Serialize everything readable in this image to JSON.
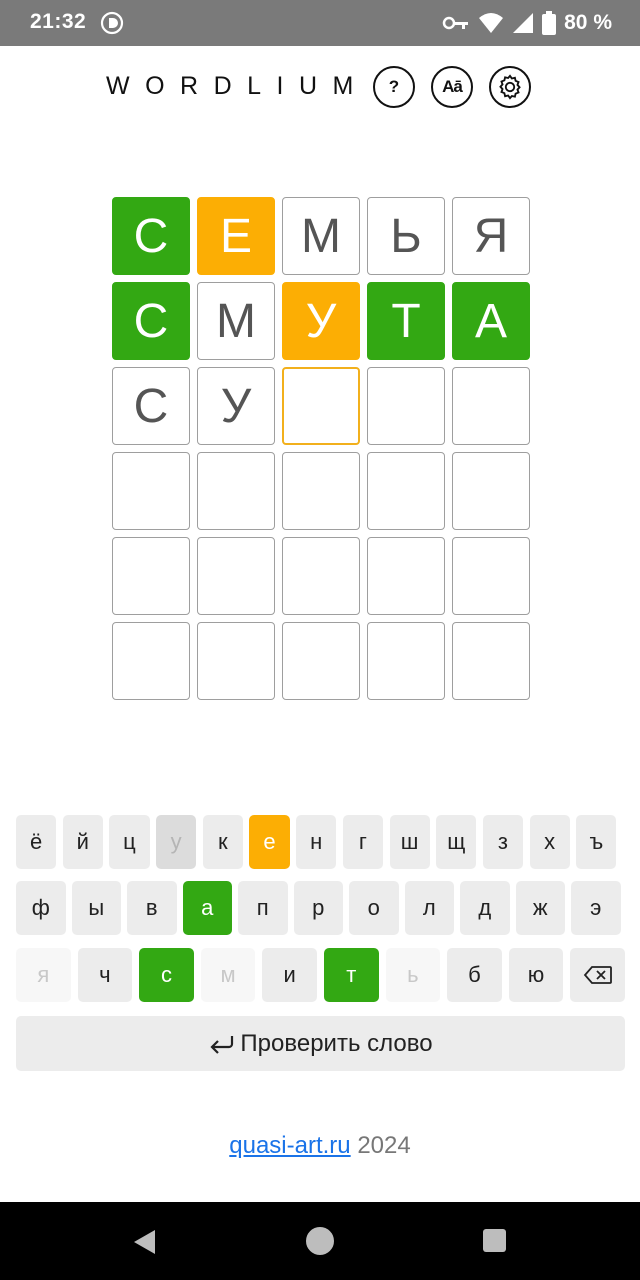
{
  "status_bar": {
    "time": "21:32",
    "battery": "80 %"
  },
  "header": {
    "title": "WORDLIUM",
    "help_label": "?",
    "language_label": "Aā"
  },
  "board": {
    "rows": [
      [
        {
          "letter": "С",
          "state": "correct"
        },
        {
          "letter": "Е",
          "state": "present"
        },
        {
          "letter": "М",
          "state": "absent"
        },
        {
          "letter": "Ь",
          "state": "absent"
        },
        {
          "letter": "Я",
          "state": "absent"
        }
      ],
      [
        {
          "letter": "С",
          "state": "correct"
        },
        {
          "letter": "М",
          "state": "absent"
        },
        {
          "letter": "У",
          "state": "present"
        },
        {
          "letter": "Т",
          "state": "correct"
        },
        {
          "letter": "А",
          "state": "correct"
        }
      ],
      [
        {
          "letter": "С",
          "state": "typed"
        },
        {
          "letter": "У",
          "state": "typed"
        },
        {
          "letter": "",
          "state": "active"
        },
        {
          "letter": "",
          "state": "empty"
        },
        {
          "letter": "",
          "state": "empty"
        }
      ],
      [
        {
          "letter": "",
          "state": "empty"
        },
        {
          "letter": "",
          "state": "empty"
        },
        {
          "letter": "",
          "state": "empty"
        },
        {
          "letter": "",
          "state": "empty"
        },
        {
          "letter": "",
          "state": "empty"
        }
      ],
      [
        {
          "letter": "",
          "state": "empty"
        },
        {
          "letter": "",
          "state": "empty"
        },
        {
          "letter": "",
          "state": "empty"
        },
        {
          "letter": "",
          "state": "empty"
        },
        {
          "letter": "",
          "state": "empty"
        }
      ],
      [
        {
          "letter": "",
          "state": "empty"
        },
        {
          "letter": "",
          "state": "empty"
        },
        {
          "letter": "",
          "state": "empty"
        },
        {
          "letter": "",
          "state": "empty"
        },
        {
          "letter": "",
          "state": "empty"
        }
      ]
    ]
  },
  "keyboard": {
    "row1": [
      {
        "key": "ё",
        "state": "normal"
      },
      {
        "key": "й",
        "state": "normal"
      },
      {
        "key": "ц",
        "state": "normal"
      },
      {
        "key": "у",
        "state": "used"
      },
      {
        "key": "к",
        "state": "normal"
      },
      {
        "key": "е",
        "state": "present"
      },
      {
        "key": "н",
        "state": "normal"
      },
      {
        "key": "г",
        "state": "normal"
      },
      {
        "key": "ш",
        "state": "normal"
      },
      {
        "key": "щ",
        "state": "normal"
      },
      {
        "key": "з",
        "state": "normal"
      },
      {
        "key": "х",
        "state": "normal"
      },
      {
        "key": "ъ",
        "state": "normal"
      }
    ],
    "row2": [
      {
        "key": "ф",
        "state": "normal"
      },
      {
        "key": "ы",
        "state": "normal"
      },
      {
        "key": "в",
        "state": "normal"
      },
      {
        "key": "а",
        "state": "correct"
      },
      {
        "key": "п",
        "state": "normal"
      },
      {
        "key": "р",
        "state": "normal"
      },
      {
        "key": "о",
        "state": "normal"
      },
      {
        "key": "л",
        "state": "normal"
      },
      {
        "key": "д",
        "state": "normal"
      },
      {
        "key": "ж",
        "state": "normal"
      },
      {
        "key": "э",
        "state": "normal"
      }
    ],
    "row3": [
      {
        "key": "я",
        "state": "absent"
      },
      {
        "key": "ч",
        "state": "normal"
      },
      {
        "key": "с",
        "state": "correct"
      },
      {
        "key": "м",
        "state": "absent"
      },
      {
        "key": "и",
        "state": "normal"
      },
      {
        "key": "т",
        "state": "correct"
      },
      {
        "key": "ь",
        "state": "absent"
      },
      {
        "key": "б",
        "state": "normal"
      },
      {
        "key": "ю",
        "state": "normal"
      }
    ],
    "check_label": "Проверить слово"
  },
  "footer": {
    "link_text": "quasi-art.ru",
    "year": " 2024"
  },
  "colors": {
    "correct": "#33a813",
    "present": "#fcae04",
    "active_border": "#f2b01c"
  }
}
